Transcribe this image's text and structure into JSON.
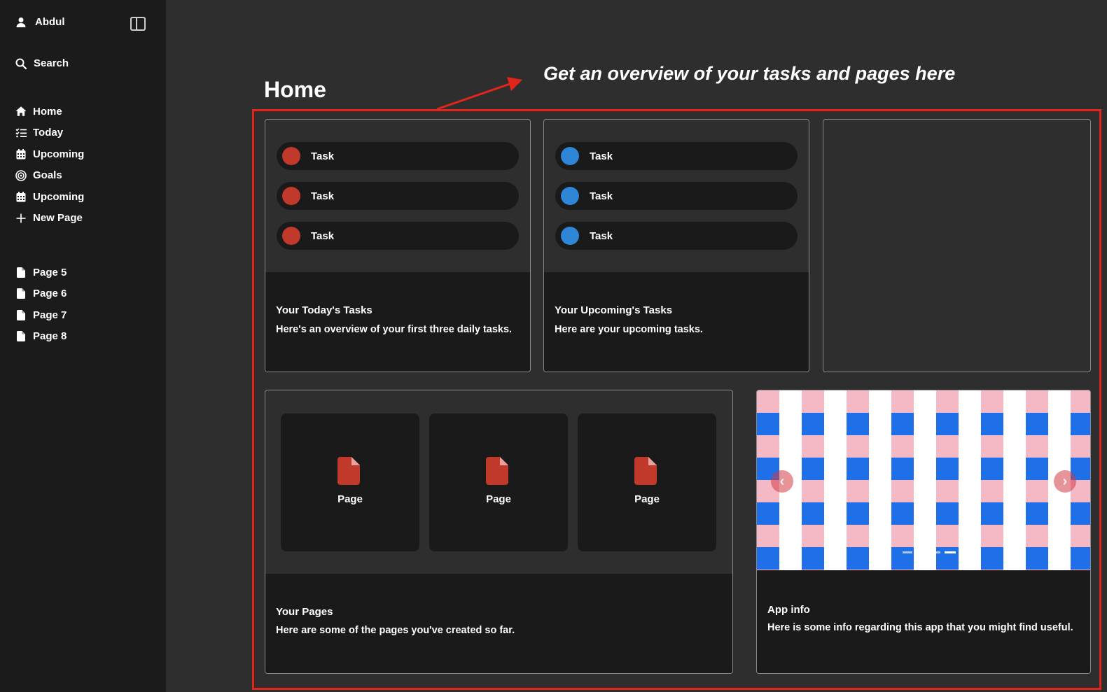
{
  "sidebar": {
    "user_name": "Abdul",
    "search_label": "Search",
    "nav": [
      {
        "label": "Home",
        "icon": "home-icon"
      },
      {
        "label": "Today",
        "icon": "checklist-icon"
      },
      {
        "label": "Upcoming",
        "icon": "calendar-icon"
      },
      {
        "label": "Goals",
        "icon": "target-icon"
      },
      {
        "label": "Upcoming",
        "icon": "calendar-icon"
      },
      {
        "label": "New Page",
        "icon": "plus-icon"
      }
    ],
    "pages": [
      {
        "label": "Page 5",
        "icon": "file-icon"
      },
      {
        "label": "Page 6",
        "icon": "file-icon"
      },
      {
        "label": "Page 7",
        "icon": "file-icon"
      },
      {
        "label": "Page 8",
        "icon": "file-icon"
      }
    ]
  },
  "main": {
    "title": "Home",
    "annotation": "Get an overview of your tasks and pages here",
    "today_card": {
      "tasks": [
        "Task",
        "Task",
        "Task"
      ],
      "dot_color": "#c0392b",
      "title": "Your Today's Tasks",
      "description": "Here's an overview of your first three daily tasks."
    },
    "upcoming_card": {
      "tasks": [
        "Task",
        "Task",
        "Task"
      ],
      "dot_color": "#2f86d6",
      "title": "Your Upcoming's Tasks",
      "description": "Here are your upcoming tasks."
    },
    "pages_card": {
      "tiles": [
        "Page",
        "Page",
        "Page"
      ],
      "title": "Your Pages",
      "description": "Here are some of the pages you've created so far."
    },
    "app_info_card": {
      "title": "App info",
      "description": "Here is some info regarding this app that you might find useful."
    }
  },
  "colors": {
    "annotation_frame": "#e1251b",
    "page_icon": "#c0392b",
    "sidebar_bg": "#1b1b1b",
    "main_bg": "#2e2e2e"
  }
}
